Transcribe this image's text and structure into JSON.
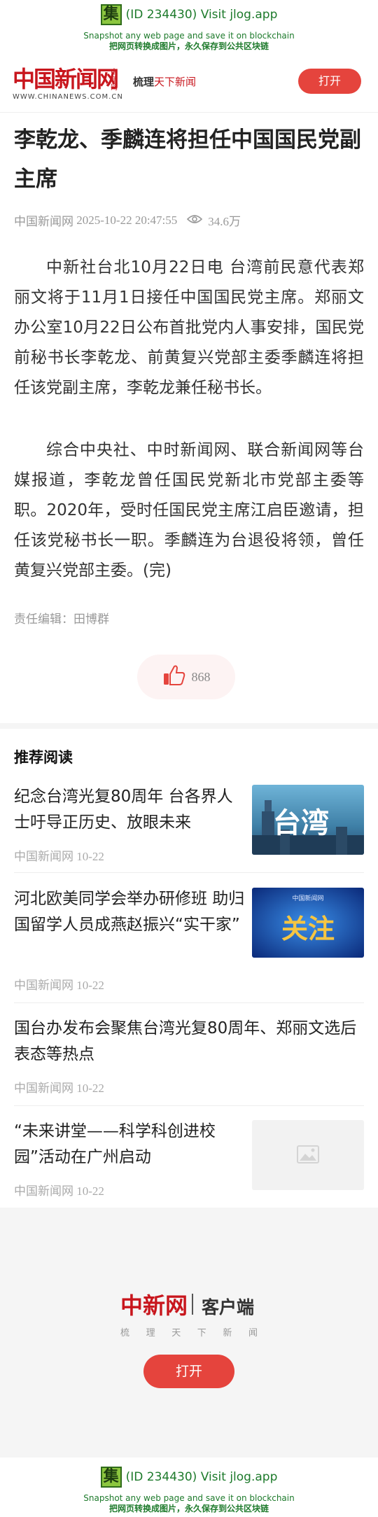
{
  "jlog": {
    "icon_char": "集",
    "line1": "(ID 234430) Visit jlog.app",
    "line2": "Snapshot any web page and save it on blockchain",
    "line3": "把网页转换成图片，永久保存到公共区块链"
  },
  "header": {
    "logo_text": "中国新闻网",
    "logo_vertical": "中新网",
    "logo_url": "WWW.CHINANEWS.COM.CN",
    "slogan_prefix": "梳理",
    "slogan_highlight": "天下新闻",
    "open_label": "打开"
  },
  "article": {
    "title": "李乾龙、季麟连将担任中国国民党副主席",
    "source": "中国新闻网",
    "datetime": "2025-10-22 20:47:55",
    "views": "34.6万",
    "paragraphs": [
      "中新社台北10月22日电 台湾前民意代表郑丽文将于11月1日接任中国国民党主席。郑丽文办公室10月22日公布首批党内人事安排，国民党前秘书长李乾龙、前黄复兴党部主委季麟连将担任该党副主席，李乾龙兼任秘书长。",
      "综合中央社、中时新闻网、联合新闻网等台媒报道，李乾龙曾任国民党新北市党部主委等职。2020年，受时任国民党主席江启臣邀请，担任该党秘书长一职。季麟连为台退役将领，曾任黄复兴党部主委。(完)"
    ],
    "editor": "责任编辑：田博群",
    "like_count": "868"
  },
  "recommend": {
    "heading": "推荐阅读",
    "items": [
      {
        "title": "纪念台湾光复80周年 台各界人士吁导正历史、放眼未来",
        "source": "中国新闻网 10-22",
        "thumb_text": "台湾"
      },
      {
        "title": "河北欧美同学会举办研修班 助归国留学人员成燕赵振兴“实干家”",
        "source": "中国新闻网 10-22",
        "thumb_text": "关注",
        "thumb_small": "中国新闻网"
      },
      {
        "title": "国台办发布会聚焦台湾光复80周年、郑丽文选后表态等热点",
        "source": "中国新闻网 10-22"
      },
      {
        "title": "“未来讲堂——科学科创进校园”活动在广州启动",
        "source": "中国新闻网 10-22"
      }
    ]
  },
  "footer": {
    "logo_text": "中新网",
    "client_label": "客户端",
    "sub_chars": [
      "梳",
      "理",
      "天",
      "下",
      "新",
      "闻"
    ],
    "open_label": "打开"
  },
  "colors": {
    "brand_red": "#c8161d",
    "button_red": "#e5443d",
    "jlog_green": "#1d7a2b"
  }
}
